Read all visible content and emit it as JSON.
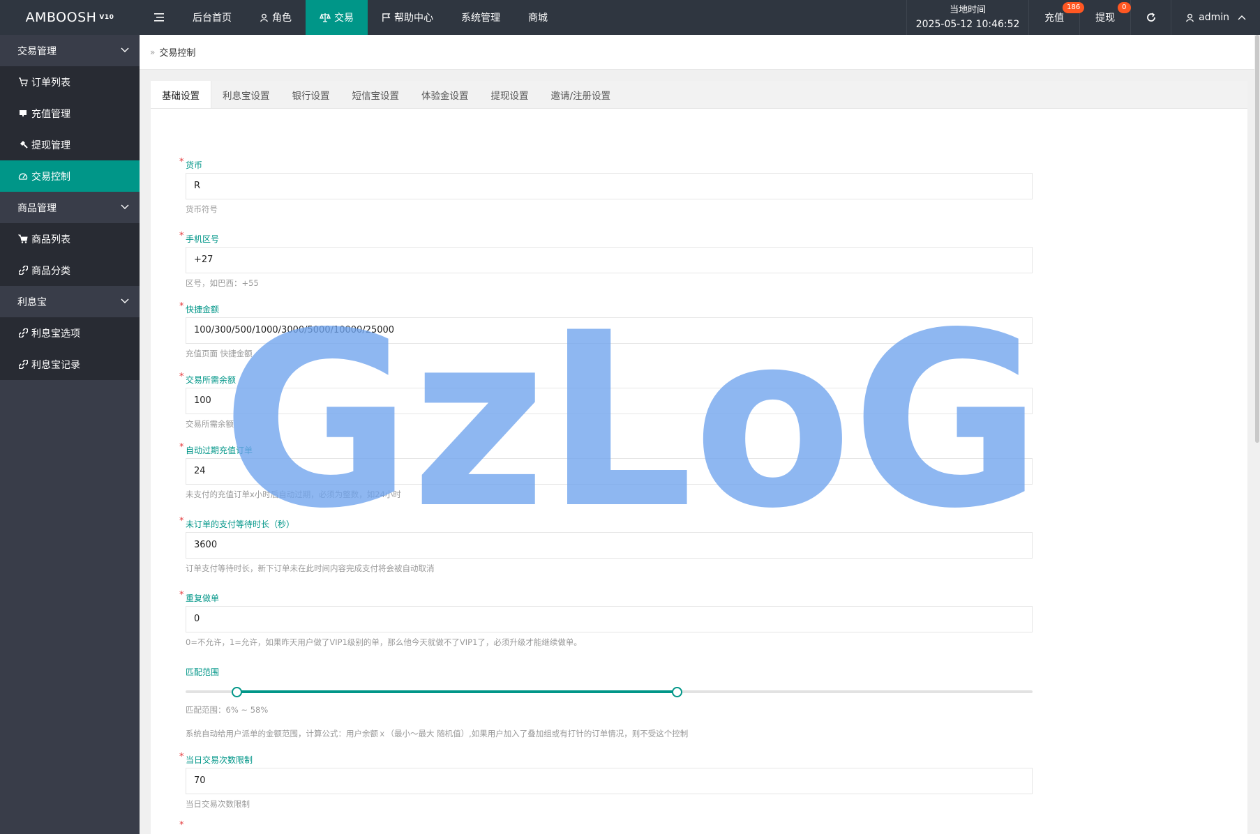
{
  "header": {
    "logo": "AMBOOSH",
    "logo_version": "V10",
    "nav": [
      {
        "label": "后台首页",
        "icon": "none"
      },
      {
        "label": "角色",
        "icon": "user-icon"
      },
      {
        "label": "交易",
        "icon": "balance-scale-icon"
      },
      {
        "label": "帮助中心",
        "icon": "flag-icon"
      },
      {
        "label": "系统管理",
        "icon": "none"
      },
      {
        "label": "商城",
        "icon": "none"
      }
    ],
    "time_label": "当地时间",
    "time_value": "2025-05-12 10:46:52",
    "recharge_label": "充值",
    "recharge_badge": "186",
    "withdraw_label": "提现",
    "withdraw_badge": "0",
    "user": "admin",
    "accent": "#009688",
    "badge_color": "#ff5722"
  },
  "sidebar": {
    "groups": [
      {
        "label": "交易管理",
        "items": [
          {
            "label": "订单列表",
            "icon": "cart-icon"
          },
          {
            "label": "充值管理",
            "icon": "card-icon"
          },
          {
            "label": "提现管理",
            "icon": "hammer-icon"
          },
          {
            "label": "交易控制",
            "icon": "gauge-icon",
            "active": true
          }
        ]
      },
      {
        "label": "商品管理",
        "items": [
          {
            "label": "商品列表",
            "icon": "cart-filled-icon"
          },
          {
            "label": "商品分类",
            "icon": "link-icon"
          }
        ]
      },
      {
        "label": "利息宝",
        "items": [
          {
            "label": "利息宝选项",
            "icon": "link-icon"
          },
          {
            "label": "利息宝记录",
            "icon": "link-icon"
          }
        ]
      }
    ]
  },
  "breadcrumb": "交易控制",
  "tabs": [
    "基础设置",
    "利息宝设置",
    "银行设置",
    "短信宝设置",
    "体验金设置",
    "提现设置",
    "邀请/注册设置"
  ],
  "form": {
    "currency": {
      "label": "货币",
      "value": "R",
      "help": "货币符号"
    },
    "phone_code": {
      "label": "手机区号",
      "value": "+27",
      "help": "区号，如巴西：+55"
    },
    "quick_amount": {
      "label": "快捷金额",
      "value": "100/300/500/1000/3000/5000/10000/25000",
      "help": "充值页面 快捷金额"
    },
    "min_balance": {
      "label": "交易所需余额",
      "value": "100",
      "help": "交易所需余额"
    },
    "auto_expire": {
      "label": "自动过期充值订单",
      "value": "24",
      "help": "未支付的充值订单x小时后自动过期，必须为整数，如24小时"
    },
    "pay_wait": {
      "label": "未订单的支付等待时长（秒）",
      "value": "3600",
      "help": "订单支付等待时长，新下订单未在此时间内容完成支付将会被自动取消"
    },
    "repeat_order": {
      "label": "重复做单",
      "value": "0",
      "help": "0=不允许，1=允许，如果昨天用户做了VIP1级别的单，那么他今天就做不了VIP1了，必须升级才能继续做单。"
    },
    "match_range": {
      "label": "匹配范围",
      "min": 6,
      "max": 58,
      "help": "匹配范围：6% ~ 58%",
      "help2": "系统自动给用户派单的金额范围，计算公式：用户余额ｘ（最小～最大 随机值）,如果用户加入了叠加组或有打针的订单情况，则不受这个控制"
    },
    "daily_limit": {
      "label": "当日交易次数限制",
      "value": "70",
      "help": "当日交易次数限制"
    }
  },
  "watermark": "GzLoG"
}
